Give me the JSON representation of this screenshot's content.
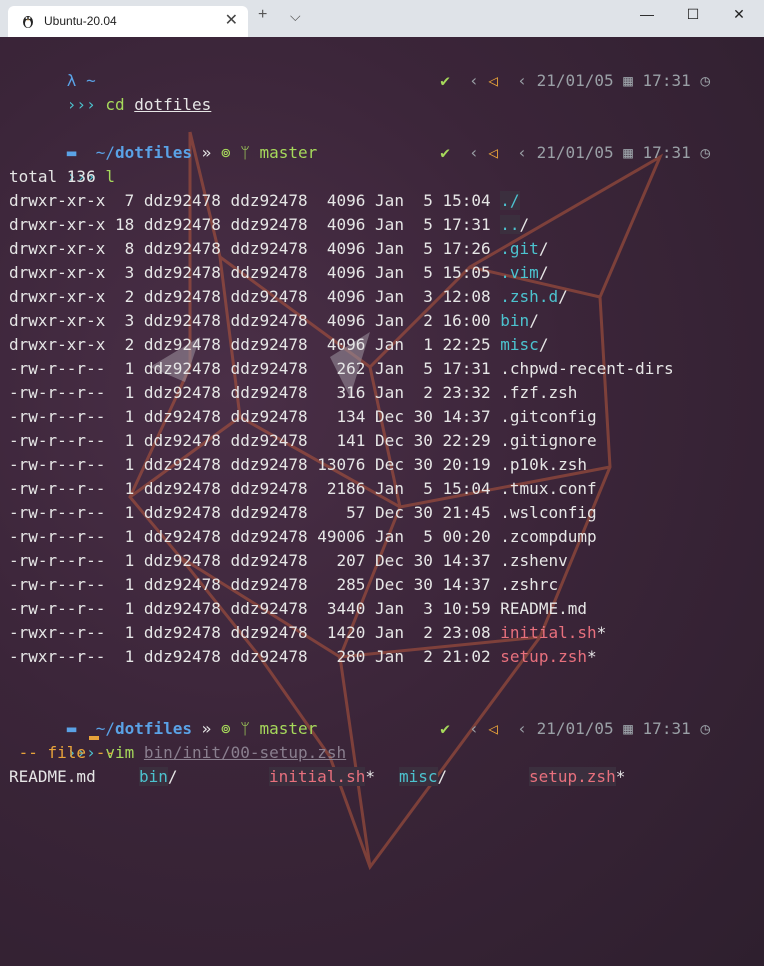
{
  "tab": {
    "title": "Ubuntu-20.04",
    "close": "✕"
  },
  "titlebar": {
    "new_tab": "+",
    "dropdown": "⌵",
    "minimize": "—",
    "maximize": "☐",
    "close": "✕"
  },
  "prompt1": {
    "lambda": "λ",
    "path": "~",
    "check": "✔",
    "chev": "‹",
    "ubuntu": "◁",
    "date": "21/01/05",
    "time": "17:31"
  },
  "cmd1": {
    "prefix": "›››",
    "cmd": "cd",
    "arg": "dotfiles"
  },
  "prompt2": {
    "folder": "▬",
    "path_prefix": "~/",
    "path_bold": "dotfiles",
    "sep": "»",
    "git": "⊚",
    "branch_icon": "ᛘ",
    "branch": "master",
    "check": "✔",
    "chev": "‹",
    "ubuntu": "◁",
    "date": "21/01/05",
    "time": "17:31"
  },
  "cmd2": {
    "prefix": "›››",
    "cmd": "l"
  },
  "total": "total 136",
  "listing": [
    {
      "perm": "drwxr-xr-x",
      "links": " 7",
      "owner": "ddz92478",
      "group": "ddz92478",
      "size": " 4096",
      "mon": "Jan",
      "day": " 5",
      "time": "15:04",
      "name": "./",
      "color": "c-teal",
      "suffix": "",
      "hl": true
    },
    {
      "perm": "drwxr-xr-x",
      "links": "18",
      "owner": "ddz92478",
      "group": "ddz92478",
      "size": " 4096",
      "mon": "Jan",
      "day": " 5",
      "time": "17:31",
      "name": "..",
      "color": "c-teal",
      "suffix": "/",
      "hl": true
    },
    {
      "perm": "drwxr-xr-x",
      "links": " 8",
      "owner": "ddz92478",
      "group": "ddz92478",
      "size": " 4096",
      "mon": "Jan",
      "day": " 5",
      "time": "17:26",
      "name": ".git",
      "color": "c-teal",
      "suffix": "/",
      "hl": false
    },
    {
      "perm": "drwxr-xr-x",
      "links": " 3",
      "owner": "ddz92478",
      "group": "ddz92478",
      "size": " 4096",
      "mon": "Jan",
      "day": " 5",
      "time": "15:05",
      "name": ".vim",
      "color": "c-teal",
      "suffix": "/",
      "hl": false
    },
    {
      "perm": "drwxr-xr-x",
      "links": " 2",
      "owner": "ddz92478",
      "group": "ddz92478",
      "size": " 4096",
      "mon": "Jan",
      "day": " 3",
      "time": "12:08",
      "name": ".zsh.d",
      "color": "c-teal",
      "suffix": "/",
      "hl": false
    },
    {
      "perm": "drwxr-xr-x",
      "links": " 3",
      "owner": "ddz92478",
      "group": "ddz92478",
      "size": " 4096",
      "mon": "Jan",
      "day": " 2",
      "time": "16:00",
      "name": "bin",
      "color": "c-teal",
      "suffix": "/",
      "hl": false
    },
    {
      "perm": "drwxr-xr-x",
      "links": " 2",
      "owner": "ddz92478",
      "group": "ddz92478",
      "size": " 4096",
      "mon": "Jan",
      "day": " 1",
      "time": "22:25",
      "name": "misc",
      "color": "c-teal",
      "suffix": "/",
      "hl": false
    },
    {
      "perm": "-rw-r--r--",
      "links": " 1",
      "owner": "ddz92478",
      "group": "ddz92478",
      "size": "  262",
      "mon": "Jan",
      "day": " 5",
      "time": "17:31",
      "name": ".chpwd-recent-dirs",
      "color": "c-white",
      "suffix": "",
      "hl": false
    },
    {
      "perm": "-rw-r--r--",
      "links": " 1",
      "owner": "ddz92478",
      "group": "ddz92478",
      "size": "  316",
      "mon": "Jan",
      "day": " 2",
      "time": "23:32",
      "name": ".fzf.zsh",
      "color": "c-white",
      "suffix": "",
      "hl": false
    },
    {
      "perm": "-rw-r--r--",
      "links": " 1",
      "owner": "ddz92478",
      "group": "ddz92478",
      "size": "  134",
      "mon": "Dec",
      "day": "30",
      "time": "14:37",
      "name": ".gitconfig",
      "color": "c-white",
      "suffix": "",
      "hl": false
    },
    {
      "perm": "-rw-r--r--",
      "links": " 1",
      "owner": "ddz92478",
      "group": "ddz92478",
      "size": "  141",
      "mon": "Dec",
      "day": "30",
      "time": "22:29",
      "name": ".gitignore",
      "color": "c-white",
      "suffix": "",
      "hl": false
    },
    {
      "perm": "-rw-r--r--",
      "links": " 1",
      "owner": "ddz92478",
      "group": "ddz92478",
      "size": "13076",
      "mon": "Dec",
      "day": "30",
      "time": "20:19",
      "name": ".p10k.zsh",
      "color": "c-white",
      "suffix": "",
      "hl": false
    },
    {
      "perm": "-rw-r--r--",
      "links": " 1",
      "owner": "ddz92478",
      "group": "ddz92478",
      "size": " 2186",
      "mon": "Jan",
      "day": " 5",
      "time": "15:04",
      "name": ".tmux.conf",
      "color": "c-white",
      "suffix": "",
      "hl": false
    },
    {
      "perm": "-rw-r--r--",
      "links": " 1",
      "owner": "ddz92478",
      "group": "ddz92478",
      "size": "   57",
      "mon": "Dec",
      "day": "30",
      "time": "21:45",
      "name": ".wslconfig",
      "color": "c-white",
      "suffix": "",
      "hl": false
    },
    {
      "perm": "-rw-r--r--",
      "links": " 1",
      "owner": "ddz92478",
      "group": "ddz92478",
      "size": "49006",
      "mon": "Jan",
      "day": " 5",
      "time": "00:20",
      "name": ".zcompdump",
      "color": "c-white",
      "suffix": "",
      "hl": false
    },
    {
      "perm": "-rw-r--r--",
      "links": " 1",
      "owner": "ddz92478",
      "group": "ddz92478",
      "size": "  207",
      "mon": "Dec",
      "day": "30",
      "time": "14:37",
      "name": ".zshenv",
      "color": "c-white",
      "suffix": "",
      "hl": false
    },
    {
      "perm": "-rw-r--r--",
      "links": " 1",
      "owner": "ddz92478",
      "group": "ddz92478",
      "size": "  285",
      "mon": "Dec",
      "day": "30",
      "time": "14:37",
      "name": ".zshrc",
      "color": "c-white",
      "suffix": "",
      "hl": false
    },
    {
      "perm": "-rw-r--r--",
      "links": " 1",
      "owner": "ddz92478",
      "group": "ddz92478",
      "size": " 3440",
      "mon": "Jan",
      "day": " 3",
      "time": "10:59",
      "name": "README.md",
      "color": "c-white",
      "suffix": "",
      "hl": false
    },
    {
      "perm": "-rwxr--r--",
      "links": " 1",
      "owner": "ddz92478",
      "group": "ddz92478",
      "size": " 1420",
      "mon": "Jan",
      "day": " 2",
      "time": "23:08",
      "name": "initial.sh",
      "color": "c-red",
      "suffix": "*",
      "hl": false
    },
    {
      "perm": "-rwxr--r--",
      "links": " 1",
      "owner": "ddz92478",
      "group": "ddz92478",
      "size": "  280",
      "mon": "Jan",
      "day": " 2",
      "time": "21:02",
      "name": "setup.zsh",
      "color": "c-red",
      "suffix": "*",
      "hl": false
    }
  ],
  "prompt3": {
    "folder": "▬",
    "path_prefix": "~/",
    "path_bold": "dotfiles",
    "sep": "»",
    "git": "⊚",
    "branch_icon": "ᛘ",
    "branch": "master",
    "check": "✔",
    "chev": "‹",
    "ubuntu": "◁",
    "date": "21/01/05",
    "time": "17:31"
  },
  "cmd3": {
    "prefix": "›››",
    "cmd": "vim",
    "arg": "bin/init/00-setup.zsh"
  },
  "completion": {
    "header": " -- file --",
    "items": [
      {
        "name": "README.md",
        "color": "c-white",
        "suffix": ""
      },
      {
        "name": "bin",
        "color": "c-teal",
        "suffix": "/"
      },
      {
        "name": "initial.sh",
        "color": "c-red",
        "suffix": "*"
      },
      {
        "name": "misc",
        "color": "c-teal",
        "suffix": "/"
      },
      {
        "name": "setup.zsh",
        "color": "c-red",
        "suffix": "*"
      }
    ]
  }
}
